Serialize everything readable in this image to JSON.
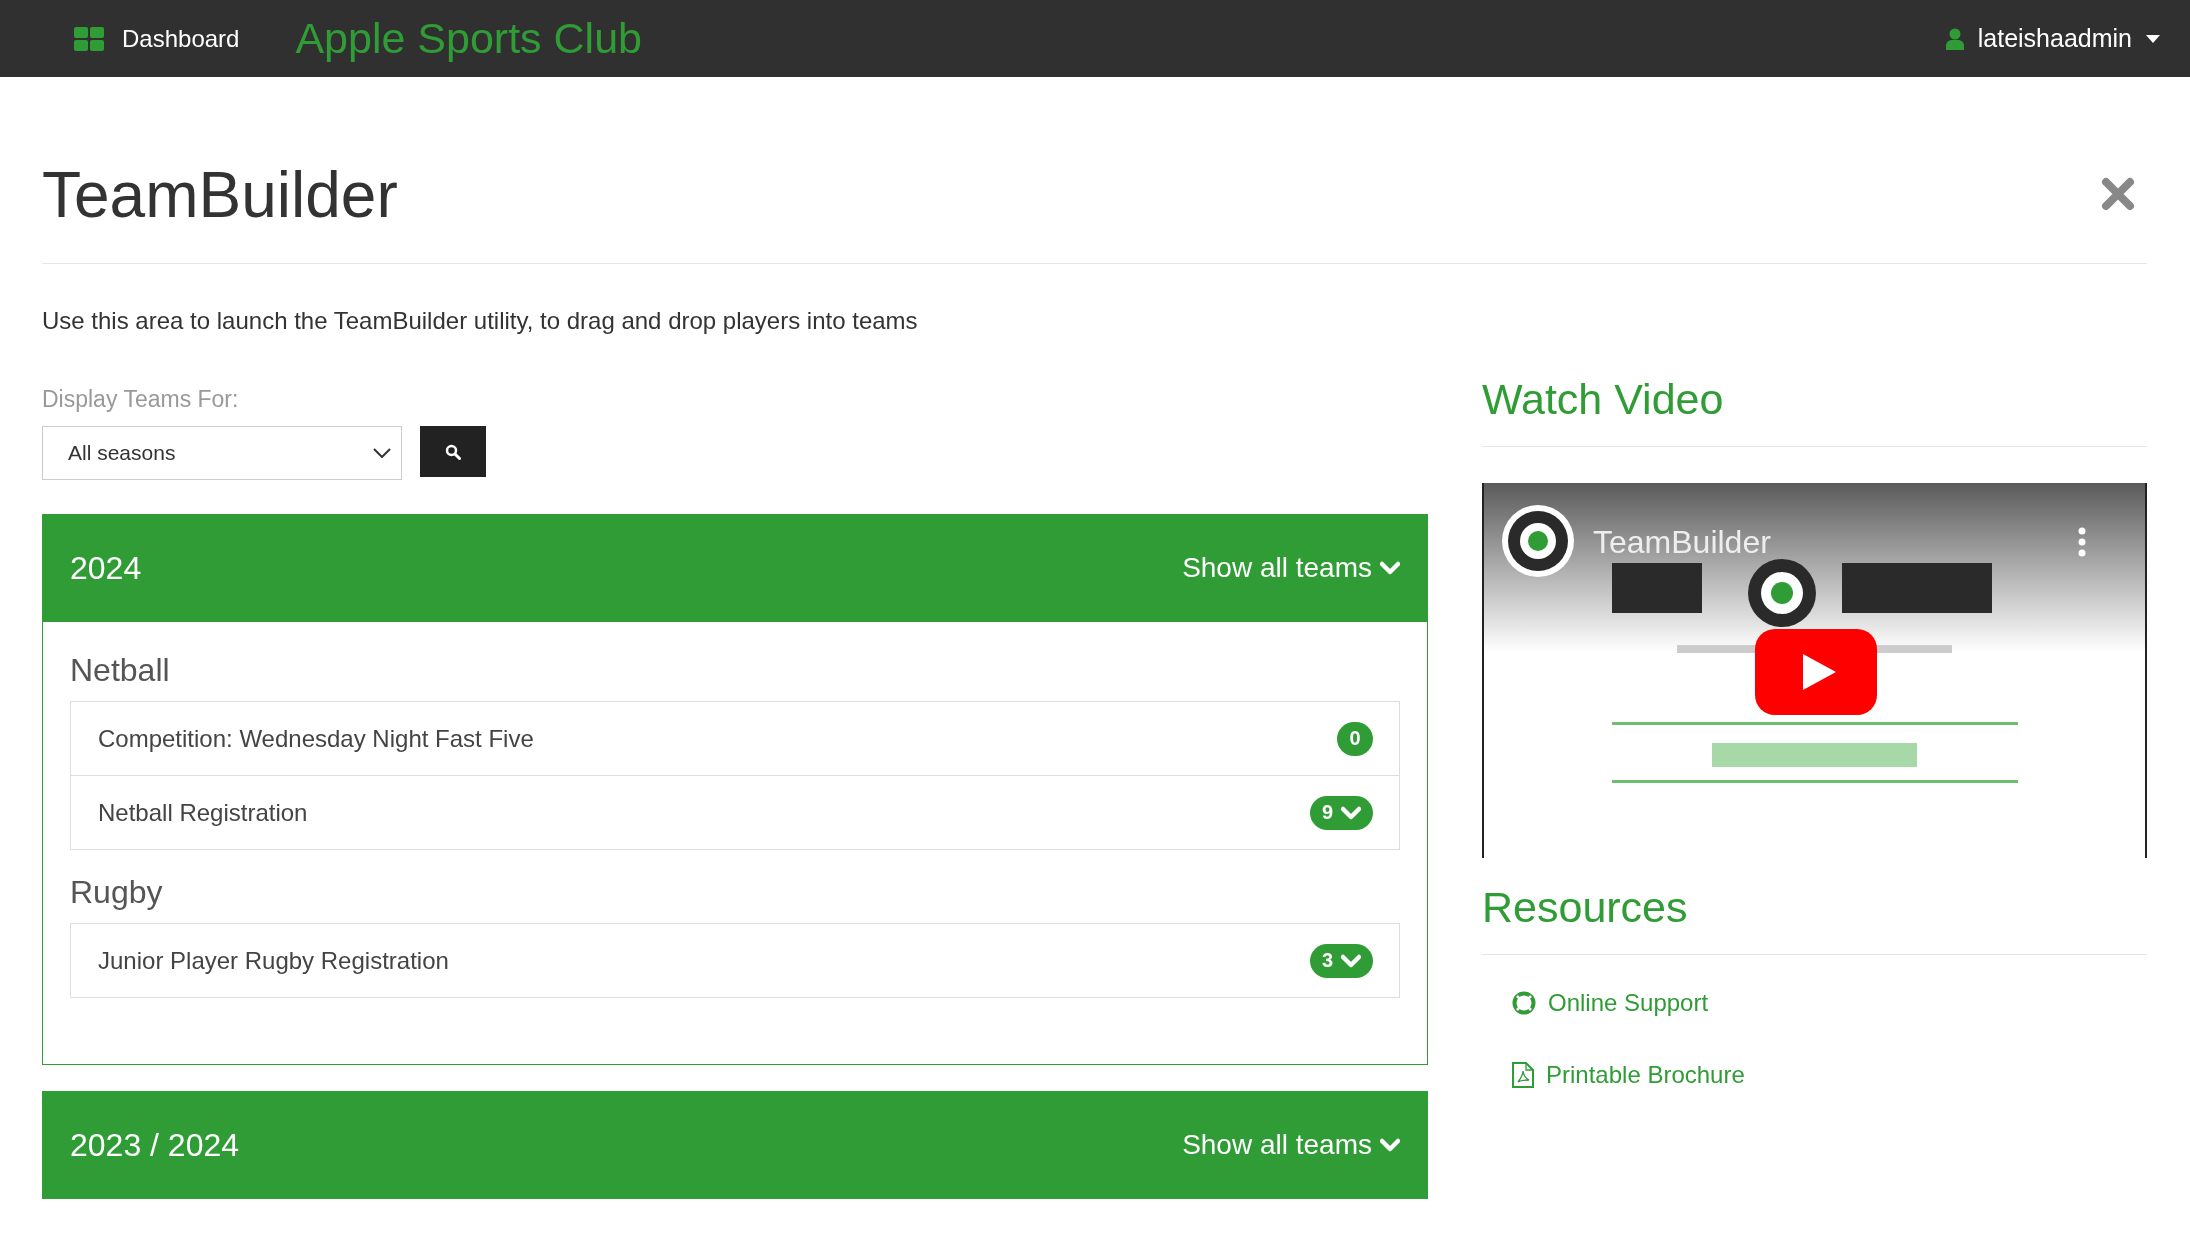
{
  "navbar": {
    "dashboard_label": "Dashboard",
    "brand": "Apple Sports Club",
    "user": "lateishaadmin"
  },
  "page": {
    "title": "TeamBuilder",
    "description": "Use this area to launch the TeamBuilder utility, to drag and drop players into teams",
    "filter": {
      "label": "Display Teams For:",
      "value": "All seasons"
    }
  },
  "seasons": [
    {
      "title": "2024",
      "toggle_label": "Show all teams",
      "sports": [
        {
          "name": "Netball",
          "items": [
            {
              "name": "Competition: Wednesday Night Fast Five",
              "count": "0",
              "expandable": false
            },
            {
              "name": "Netball Registration",
              "count": "9",
              "expandable": true
            }
          ]
        },
        {
          "name": "Rugby",
          "items": [
            {
              "name": "Junior Player Rugby Registration",
              "count": "3",
              "expandable": true
            }
          ]
        }
      ]
    },
    {
      "title": "2023 / 2024",
      "toggle_label": "Show all teams"
    }
  ],
  "sidebar": {
    "video_heading": "Watch Video",
    "video": {
      "title": "TeamBuilder"
    },
    "resources_heading": "Resources",
    "resources": [
      {
        "kind": "support",
        "label": "Online Support"
      },
      {
        "kind": "pdf",
        "label": "Printable Brochure"
      }
    ]
  }
}
